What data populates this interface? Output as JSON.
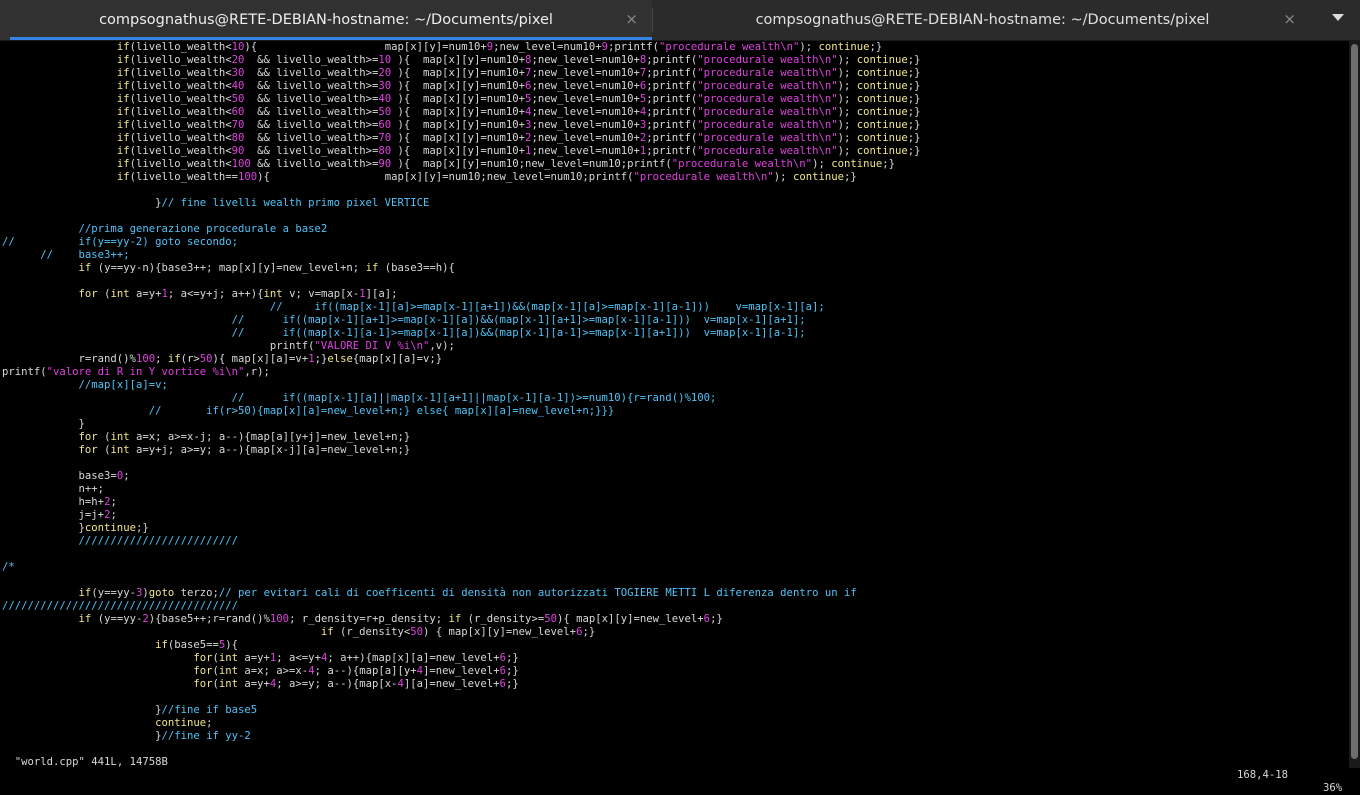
{
  "tabs": [
    {
      "title": "compsognathus@RETE-DEBIAN-hostname: ~/Documents/pixel",
      "active": true
    },
    {
      "title": "compsognathus@RETE-DEBIAN-hostname: ~/Documents/pixel",
      "active": false
    }
  ],
  "tab_close_glyph": "×",
  "colors": {
    "background": "#000000",
    "text": "#d8d8d8",
    "keyword": "#f0e68c",
    "number_string": "#e040e0",
    "comment": "#4fc3f7",
    "preproc_green": "#7ed957",
    "accent": "#3584e4"
  },
  "icons": [
    "close-icon",
    "menu-dropdown-icon"
  ],
  "editor": {
    "lines": [
      "                  if(livello_wealth<10){                    map[x][y]=num10+9;new_level=num10+9;printf(\"procedurale wealth\\n\"); continue;}",
      "                  if(livello_wealth<20  && livello_wealth>=10 ){  map[x][y]=num10+8;new_level=num10+8;printf(\"procedurale wealth\\n\"); continue;}",
      "                  if(livello_wealth<30  && livello_wealth>=20 ){  map[x][y]=num10+7;new_level=num10+7;printf(\"procedurale wealth\\n\"); continue;}",
      "                  if(livello_wealth<40  && livello_wealth>=30 ){  map[x][y]=num10+6;new_level=num10+6;printf(\"procedurale wealth\\n\"); continue;}",
      "                  if(livello_wealth<50  && livello_wealth>=40 ){  map[x][y]=num10+5;new_level=num10+5;printf(\"procedurale wealth\\n\"); continue;}",
      "                  if(livello_wealth<60  && livello_wealth>=50 ){  map[x][y]=num10+4;new_level=num10+4;printf(\"procedurale wealth\\n\"); continue;}",
      "                  if(livello_wealth<70  && livello_wealth>=60 ){  map[x][y]=num10+3;new_level=num10+3;printf(\"procedurale wealth\\n\"); continue;}",
      "                  if(livello_wealth<80  && livello_wealth>=70 ){  map[x][y]=num10+2;new_level=num10+2;printf(\"procedurale wealth\\n\"); continue;}",
      "                  if(livello_wealth<90  && livello_wealth>=80 ){  map[x][y]=num10+1;new_level=num10+1;printf(\"procedurale wealth\\n\"); continue;}",
      "                  if(livello_wealth<100 && livello_wealth>=90 ){  map[x][y]=num10;new_level=num10;printf(\"procedurale wealth\\n\"); continue;}",
      "                  if(livello_wealth==100){                  map[x][y]=num10;new_level=num10;printf(\"procedurale wealth\\n\"); continue;}",
      "",
      "                        }// fine livelli wealth primo pixel VERTICE",
      "",
      "            //prima generazione procedurale a base2",
      "//          if(y==yy-2) goto secondo;",
      "      //    base3++;",
      "            if (y==yy-n){base3++; map[x][y]=new_level+n; if (base3==h){",
      "",
      "            for (int a=y+1; a<=y+j; a++){int v; v=map[x-1][a];",
      "                                          //     if((map[x-1][a]>=map[x-1][a+1])&&(map[x-1][a]>=map[x-1][a-1]))    v=map[x-1][a];",
      "                                    //      if((map[x-1][a+1]>=map[x-1][a])&&(map[x-1][a+1]>=map[x-1][a-1]))  v=map[x-1][a+1];",
      "                                    //      if((map[x-1][a-1]>=map[x-1][a])&&(map[x-1][a-1]>=map[x-1][a+1]))  v=map[x-1][a-1];",
      "                                          printf(\"VALORE DI V %i\\n\",v);",
      "            r=rand()%100; if(r>50){ map[x][a]=v+1;}else{map[x][a]=v;}",
      "printf(\"valore di R in Y vortice %i\\n\",r);",
      "            //map[x][a]=v;",
      "                                    //      if((map[x-1][a]||map[x-1][a+1]||map[x-1][a-1])>=num10){r=rand()%100;",
      "                       //       if(r>50){map[x][a]=new_level+n;} else{ map[x][a]=new_level+n;}}}",
      "            }",
      "            for (int a=x; a>=x-j; a--){map[a][y+j]=new_level+n;}",
      "            for (int a=y+j; a>=y; a--){map[x-j][a]=new_level+n;}",
      "",
      "            base3=0;",
      "            n++;",
      "            h=h+2;",
      "            j=j+2;",
      "            }continue;}",
      "            /////////////////////////",
      "",
      "/*",
      "",
      "            if(y==yy-3)goto terzo;// per evitari cali di coefficenti di densità non autorizzati TOGIERE METTI L diferenza dentro un if",
      "/////////////////////////////////////",
      "            if (y==yy-2){base5++;r=rand()%100; r_density=r+p_density; if (r_density>=50){ map[x][y]=new_level+6;}",
      "                                                  if (r_density<50) { map[x][y]=new_level+6;}",
      "                        if(base5==5){",
      "                              for(int a=y+1; a<=y+4; a++){map[x][a]=new_level+6;}",
      "                              for(int a=x; a>=x-4; a--){map[a][y+4]=new_level+6;}",
      "                              for(int a=y+4; a>=y; a--){map[x-4][a]=new_level+6;}",
      "",
      "                        }//fine if base5",
      "                        continue;",
      "                        }//fine if yy-2"
    ]
  },
  "statusbar": {
    "file_info": "\"world.cpp\" 441L, 14758B",
    "cursor_pos": "168,4-18",
    "scroll_pct": "36%"
  }
}
